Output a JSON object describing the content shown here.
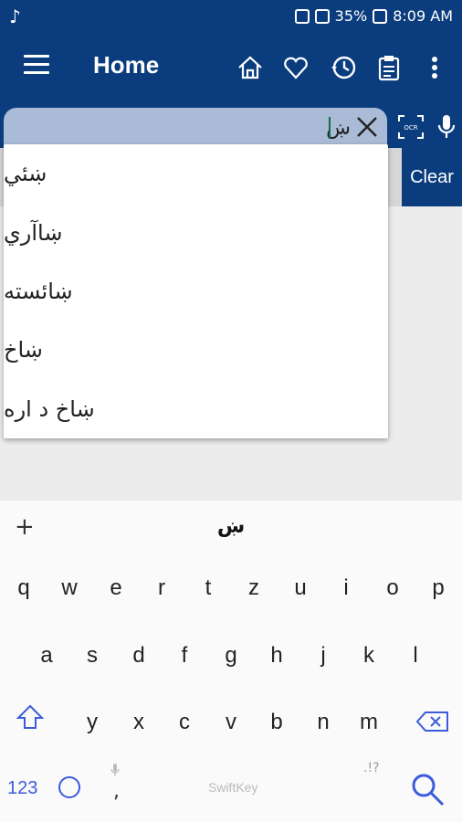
{
  "status": {
    "battery": "35%",
    "time": "8:09 AM"
  },
  "appbar": {
    "title": "Home"
  },
  "search": {
    "query": "ښ"
  },
  "clear_button": "Clear",
  "suggestions": [
    "ښئي",
    "ښاآري",
    "ښائسته",
    "ښاخ",
    "ښاخ د اره"
  ],
  "keyboard": {
    "prediction": "ښ",
    "row1": [
      "q",
      "w",
      "e",
      "r",
      "t",
      "z",
      "u",
      "i",
      "o",
      "p"
    ],
    "row2": [
      "a",
      "s",
      "d",
      "f",
      "g",
      "h",
      "j",
      "k",
      "l"
    ],
    "row3": [
      "y",
      "x",
      "c",
      "v",
      "b",
      "n",
      "m"
    ],
    "num_label": "123",
    "comma": ",",
    "space_label": "SwiftKey",
    "punct": ".!?",
    "accent": "#3b5bdb"
  },
  "colors": {
    "primary": "#0b3d7e",
    "search_bg": "#a9bbd6"
  }
}
